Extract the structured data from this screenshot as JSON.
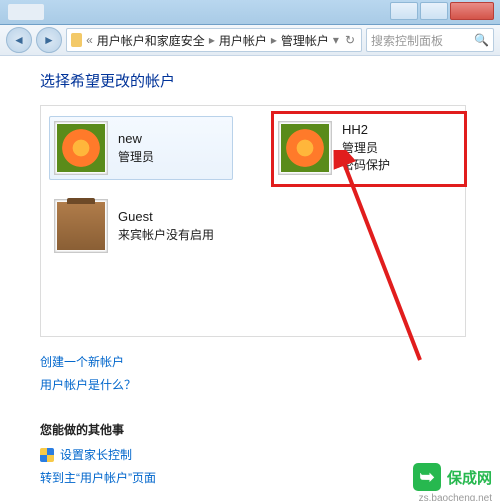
{
  "breadcrumb": {
    "seg1": "用户帐户和家庭安全",
    "seg2": "用户帐户",
    "seg3": "管理帐户"
  },
  "search": {
    "placeholder": "搜索控制面板"
  },
  "heading": "选择希望更改的帐户",
  "accounts": {
    "a1": {
      "name": "new",
      "role": "管理员"
    },
    "a2": {
      "name": "HH2",
      "role": "管理员",
      "pw": "密码保护"
    },
    "a3": {
      "name": "Guest",
      "role": "来宾帐户没有启用"
    }
  },
  "links": {
    "create": "创建一个新帐户",
    "whatis": "用户帐户是什么？"
  },
  "other": {
    "heading": "您能做的其他事",
    "parental": "设置家长控制",
    "gomain": "转到主“用户帐户”页面"
  },
  "badge": {
    "text": "保成网",
    "domain": "zs.baocheng.net"
  }
}
